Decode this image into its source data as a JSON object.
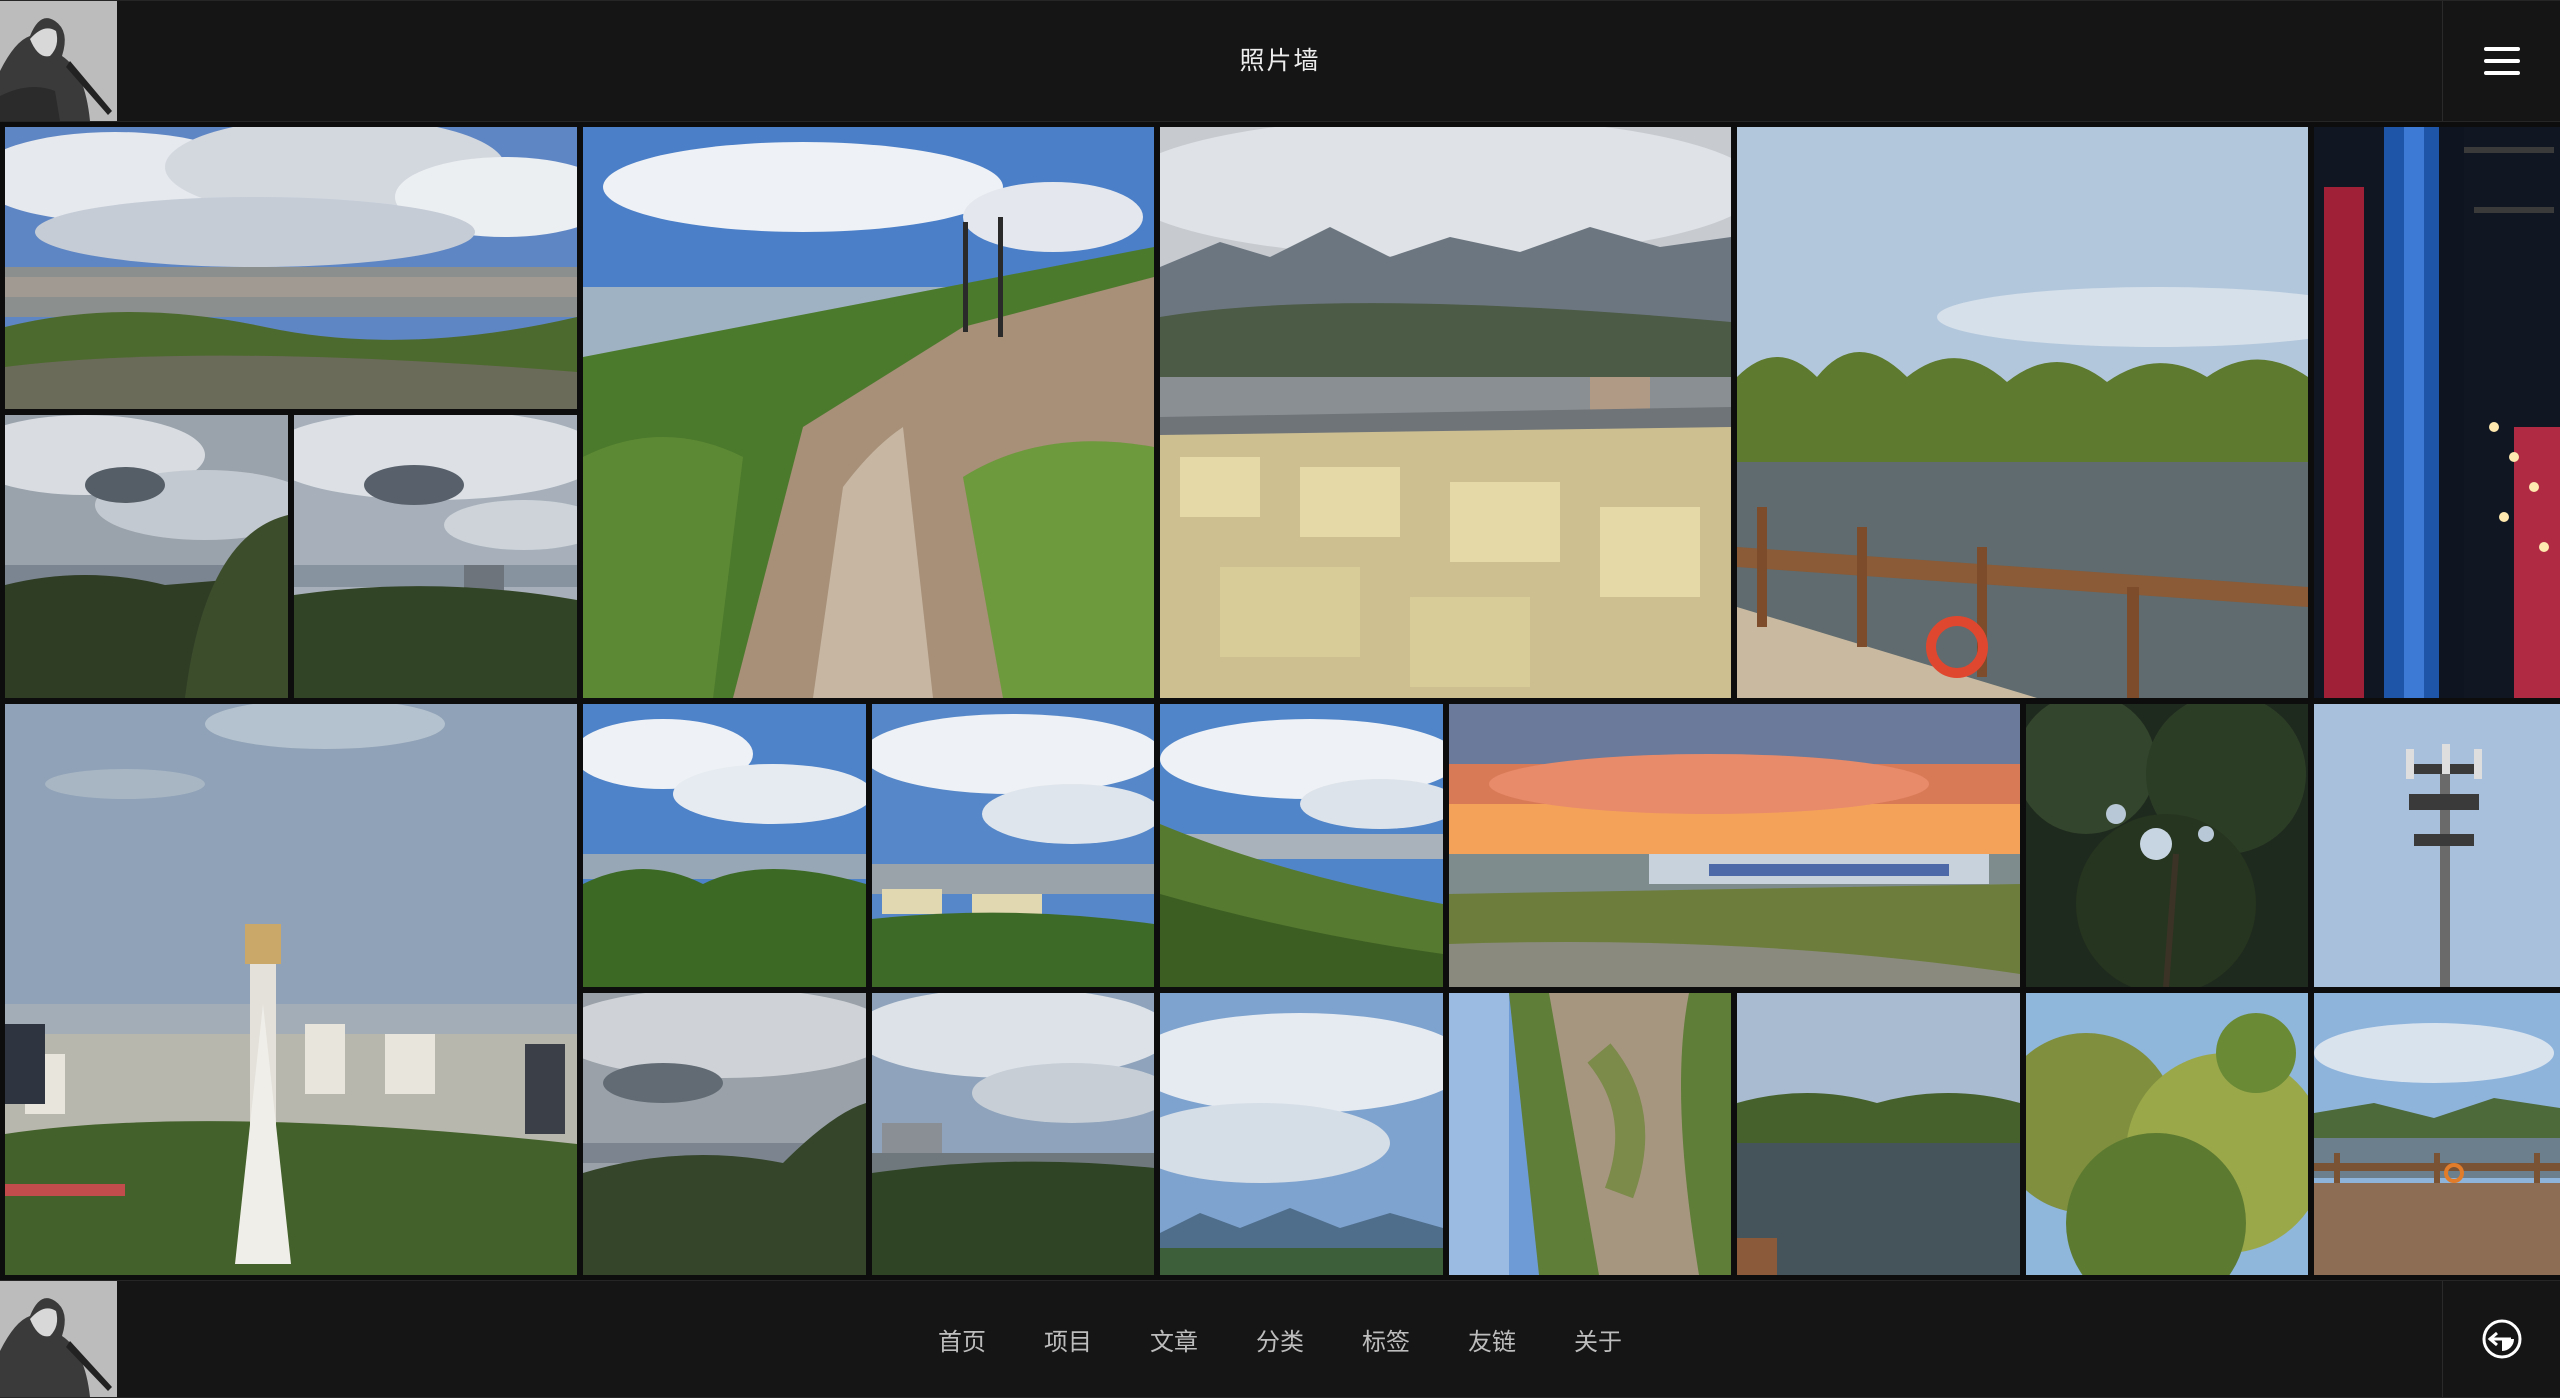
{
  "header": {
    "title": "照片墙"
  },
  "nav": {
    "items": [
      {
        "label": "首页"
      },
      {
        "label": "项目"
      },
      {
        "label": "文章"
      },
      {
        "label": "分类"
      },
      {
        "label": "标签"
      },
      {
        "label": "友链"
      },
      {
        "label": "关于"
      }
    ]
  },
  "icons": {
    "menu": "hamburger-menu-icon",
    "theme": "theme-toggle-icon",
    "avatar": "avatar-image"
  },
  "colors": {
    "bar_background": "#151515",
    "page_background": "#0d0d0d",
    "title_text": "#ededed",
    "nav_text": "#bdbdbd"
  }
}
